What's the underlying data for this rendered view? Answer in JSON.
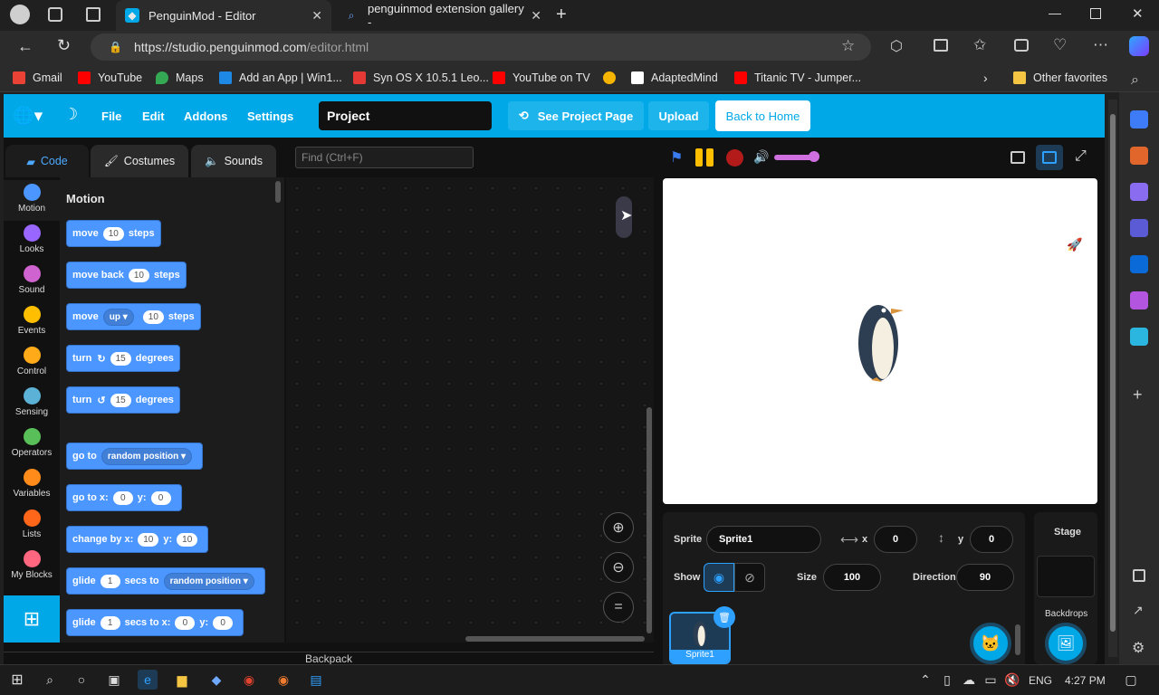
{
  "browser": {
    "tabs": [
      {
        "title": "PenguinMod - Editor",
        "active": true
      },
      {
        "title": "penguinmod extension gallery -",
        "active": false
      }
    ],
    "url_host": "https://studio.penguinmod.com",
    "url_path": "/editor.html",
    "favorites": [
      "Gmail",
      "YouTube",
      "Maps",
      "Add an App | Win1...",
      "Syn OS X 10.5.1 Leo...",
      "YouTube on TV",
      "AdaptedMind",
      "Titanic TV - Jumper..."
    ],
    "other_favorites": "Other favorites"
  },
  "menu": {
    "items": [
      "File",
      "Edit",
      "Addons",
      "Settings"
    ],
    "project_name": "Project",
    "see_project_page": "See Project Page",
    "upload": "Upload",
    "back_home": "Back to Home"
  },
  "editor_tabs": [
    "Code",
    "Costumes",
    "Sounds"
  ],
  "find_placeholder": "Find (Ctrl+F)",
  "categories": [
    {
      "label": "Motion",
      "color": "#4c97ff"
    },
    {
      "label": "Looks",
      "color": "#9966ff"
    },
    {
      "label": "Sound",
      "color": "#cf63cf"
    },
    {
      "label": "Events",
      "color": "#ffbf00"
    },
    {
      "label": "Control",
      "color": "#ffab19"
    },
    {
      "label": "Sensing",
      "color": "#5cb1d6"
    },
    {
      "label": "Operators",
      "color": "#59c059"
    },
    {
      "label": "Variables",
      "color": "#ff8c1a"
    },
    {
      "label": "Lists",
      "color": "#ff661a"
    },
    {
      "label": "My Blocks",
      "color": "#ff6680"
    }
  ],
  "palette": {
    "title": "Motion",
    "blocks": {
      "move": {
        "a": "move",
        "v1": "10",
        "b": "steps"
      },
      "move_back": {
        "a": "move back",
        "v1": "10",
        "b": "steps"
      },
      "move_up": {
        "a": "move",
        "dd": "up",
        "v1": "10",
        "b": "steps"
      },
      "turn_cw": {
        "a": "turn",
        "v1": "15",
        "b": "degrees"
      },
      "turn_ccw": {
        "a": "turn",
        "v1": "15",
        "b": "degrees"
      },
      "goto": {
        "a": "go to",
        "dd": "random position"
      },
      "goto_xy": {
        "a": "go to x:",
        "v1": "0",
        "b": "y:",
        "v2": "0"
      },
      "change_by": {
        "a": "change by x:",
        "v1": "10",
        "b": "y:",
        "v2": "10"
      },
      "glide_to": {
        "a": "glide",
        "v1": "1",
        "b": "secs to",
        "dd": "random position"
      },
      "glide_xy": {
        "a": "glide",
        "v1": "1",
        "b": "secs to x:",
        "v2": "0",
        "c": "y:",
        "v3": "0"
      }
    }
  },
  "backpack": "Backpack",
  "sprite": {
    "label_sprite": "Sprite",
    "name": "Sprite1",
    "x_label": "x",
    "x": "0",
    "y_label": "y",
    "y": "0",
    "show_label": "Show",
    "size_label": "Size",
    "size": "100",
    "direction_label": "Direction",
    "direction": "90",
    "thumb_name": "Sprite1"
  },
  "stage_panel": {
    "title": "Stage",
    "backdrops": "Backdrops"
  },
  "taskbar": {
    "lang": "ENG",
    "time": "4:27 PM"
  },
  "colors": {
    "accent": "#00a8e8",
    "motion": "#4c97ff"
  }
}
